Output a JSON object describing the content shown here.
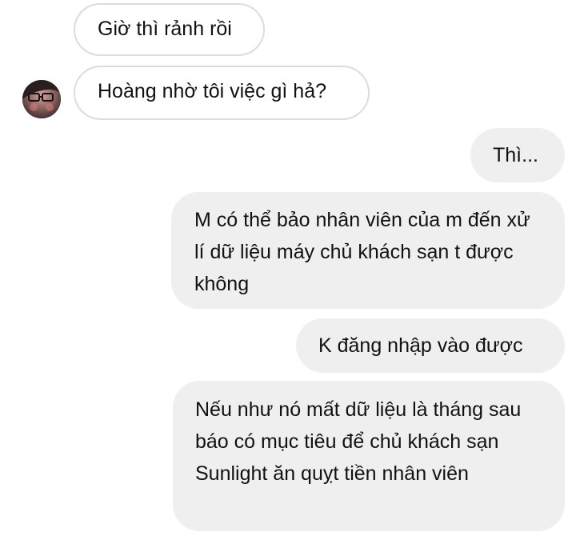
{
  "conversation": {
    "messages": [
      {
        "direction": "incoming",
        "text": "Giờ thì rảnh rồi"
      },
      {
        "direction": "incoming",
        "text": "Hoàng nhờ tôi việc gì hả?",
        "has_avatar": true
      },
      {
        "direction": "outgoing",
        "text": "Thì..."
      },
      {
        "direction": "outgoing",
        "text": "M có thể bảo nhân viên của m đến xử lí dữ liệu máy chủ khách sạn t được không"
      },
      {
        "direction": "outgoing",
        "text": "K đăng nhập vào được"
      },
      {
        "direction": "outgoing",
        "text": "Nếu như nó mất dữ liệu là tháng sau báo có mục tiêu để chủ khách sạn Sunlight ăn quỵt tiền nhân viên"
      }
    ]
  },
  "colors": {
    "incoming_border": "#dcdcdc",
    "outgoing_bg": "#efefef",
    "text": "#111111"
  },
  "icons": {
    "avatar": "user-avatar-photo"
  }
}
